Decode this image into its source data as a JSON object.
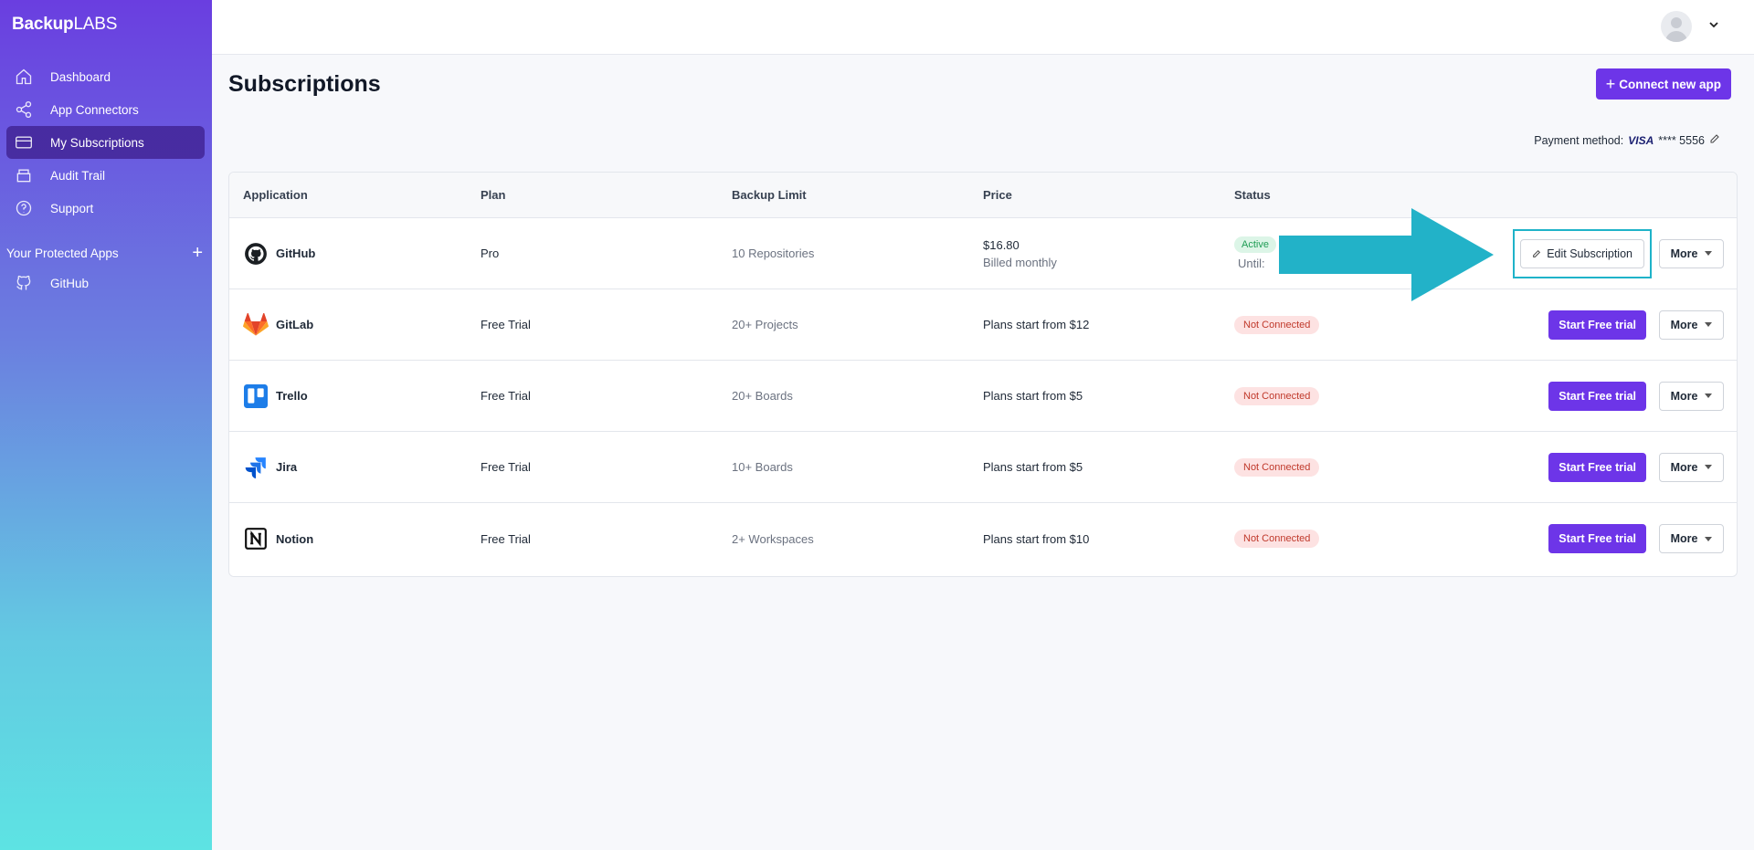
{
  "brand": {
    "bold": "Backup",
    "light": "LABS"
  },
  "sidebar": {
    "items": [
      {
        "label": "Dashboard",
        "icon": "home-icon"
      },
      {
        "label": "App Connectors",
        "icon": "share-icon"
      },
      {
        "label": "My Subscriptions",
        "icon": "card-icon"
      },
      {
        "label": "Audit Trail",
        "icon": "archive-icon"
      },
      {
        "label": "Support",
        "icon": "help-icon"
      }
    ],
    "section_title": "Your Protected Apps",
    "protected_apps": [
      {
        "label": "GitHub",
        "icon": "github-icon"
      }
    ]
  },
  "main": {
    "title": "Subscriptions",
    "connect_label": "Connect new app",
    "payment": {
      "label": "Payment method:",
      "brand": "VISA",
      "masked": "**** 5556"
    }
  },
  "table": {
    "headers": [
      "Application",
      "Plan",
      "Backup Limit",
      "Price",
      "Status"
    ],
    "rows": [
      {
        "app": "GitHub",
        "plan": "Pro",
        "limit": "10 Repositories",
        "price": "$16.80",
        "price_sub": "Billed monthly",
        "status": "Active",
        "until": "Until:",
        "action": "Edit Subscription",
        "more": "More"
      },
      {
        "app": "GitLab",
        "plan": "Free Trial",
        "limit": "20+ Projects",
        "price": "Plans start from $12",
        "status": "Not Connected",
        "action": "Start Free trial",
        "more": "More"
      },
      {
        "app": "Trello",
        "plan": "Free Trial",
        "limit": "20+ Boards",
        "price": "Plans start from $5",
        "status": "Not Connected",
        "action": "Start Free trial",
        "more": "More"
      },
      {
        "app": "Jira",
        "plan": "Free Trial",
        "limit": "10+ Boards",
        "price": "Plans start from $5",
        "status": "Not Connected",
        "action": "Start Free trial",
        "more": "More"
      },
      {
        "app": "Notion",
        "plan": "Free Trial",
        "limit": "2+ Workspaces",
        "price": "Plans start from $10",
        "status": "Not Connected",
        "action": "Start Free trial",
        "more": "More"
      }
    ]
  },
  "colors": {
    "accent": "#6d35e8",
    "annotation": "#1fb3c9"
  }
}
